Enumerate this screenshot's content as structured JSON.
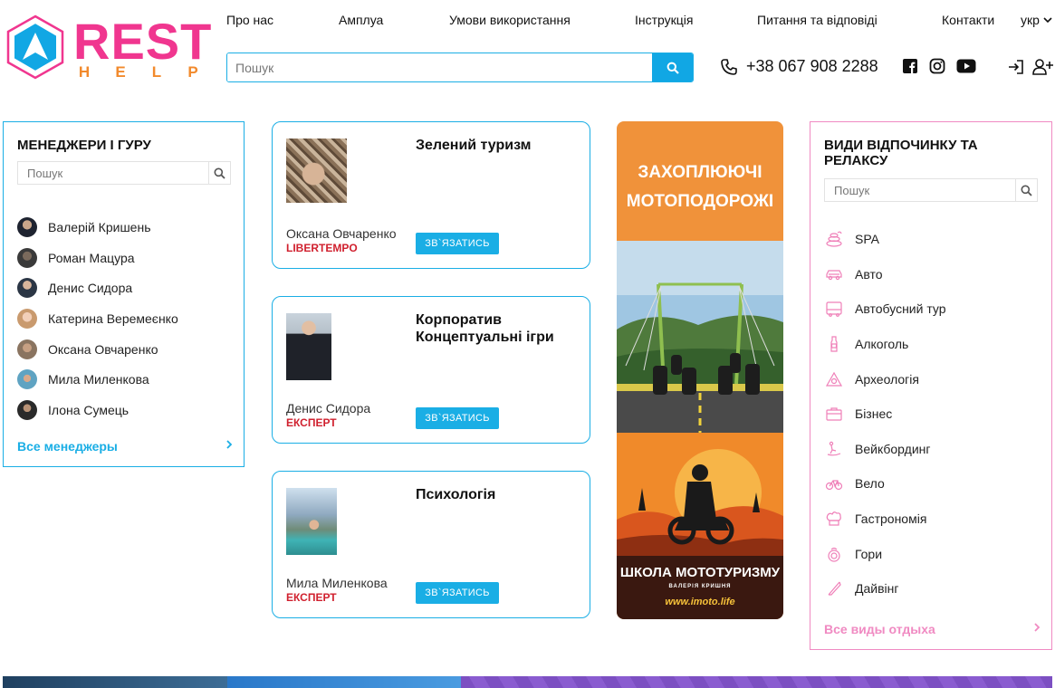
{
  "brand": {
    "name": "REST",
    "sub_letters": [
      "H",
      "E",
      "L",
      "P"
    ],
    "colors": {
      "pink": "#f0368f",
      "orange": "#f28a2c",
      "blue": "#11a7e4"
    }
  },
  "nav": {
    "items": [
      {
        "label": "Про нас"
      },
      {
        "label": "Амплуа"
      },
      {
        "label": "Умови використання"
      },
      {
        "label": "Інструкція"
      },
      {
        "label": "Питання та відповіді"
      },
      {
        "label": "Контакти"
      }
    ],
    "language": "укр"
  },
  "search": {
    "placeholder": "Пошук"
  },
  "phone": "+38 067 908 2288",
  "managers_panel": {
    "title": "МЕНЕДЖЕРИ І ГУРУ",
    "search_placeholder": "Пошук",
    "managers": [
      {
        "name": "Валерій Кришень"
      },
      {
        "name": "Роман Мацура"
      },
      {
        "name": "Денис Сидора"
      },
      {
        "name": "Катерина Веремеєнко"
      },
      {
        "name": "Оксана Овчаренко"
      },
      {
        "name": "Мила Миленкова"
      },
      {
        "name": "Ілона Сумець"
      }
    ],
    "all_link": "Все менеджеры"
  },
  "cards": [
    {
      "title": "Зелений туризм",
      "name": "Оксана Овчаренко",
      "role": "LIBERTEMPO",
      "button": "ЗВ`ЯЗАТИСЬ"
    },
    {
      "title": "Корпоратив\nКонцептуальні ігри",
      "name": "Денис Сидора",
      "role": "ЕКСПЕРТ",
      "button": "ЗВ`ЯЗАТИСЬ"
    },
    {
      "title": "Психологія",
      "name": "Мила Миленкова",
      "role": "ЕКСПЕРТ",
      "button": "ЗВ`ЯЗАТИСЬ"
    }
  ],
  "ad": {
    "headline_1": "ЗАХОПЛЮЮЧІ",
    "headline_2": "МОТОПОДОРОЖІ",
    "school": "ШКОЛА МОТОТУРИЗМУ",
    "subtitle": "ВАЛЕРІЯ КРИШНЯ",
    "url": "www.imoto.life"
  },
  "types_panel": {
    "title": "ВИДИ ВІДПОЧИНКУ ТА РЕЛАКСУ",
    "search_placeholder": "Пошук",
    "items": [
      {
        "label": "SPA",
        "icon": "spa-icon"
      },
      {
        "label": "Авто",
        "icon": "car-icon"
      },
      {
        "label": "Автобусний тур",
        "icon": "bus-icon"
      },
      {
        "label": "Алкоголь",
        "icon": "bottle-icon"
      },
      {
        "label": "Археологія",
        "icon": "archaeology-icon"
      },
      {
        "label": "Бізнес",
        "icon": "briefcase-icon"
      },
      {
        "label": "Вейкбординг",
        "icon": "wakeboard-icon"
      },
      {
        "label": "Вело",
        "icon": "bicycle-icon"
      },
      {
        "label": "Гастрономія",
        "icon": "chef-hat-icon"
      },
      {
        "label": "Гори",
        "icon": "mountain-icon"
      },
      {
        "label": "Дайвінг",
        "icon": "diving-icon"
      }
    ],
    "all_link": "Все виды отдыха"
  }
}
